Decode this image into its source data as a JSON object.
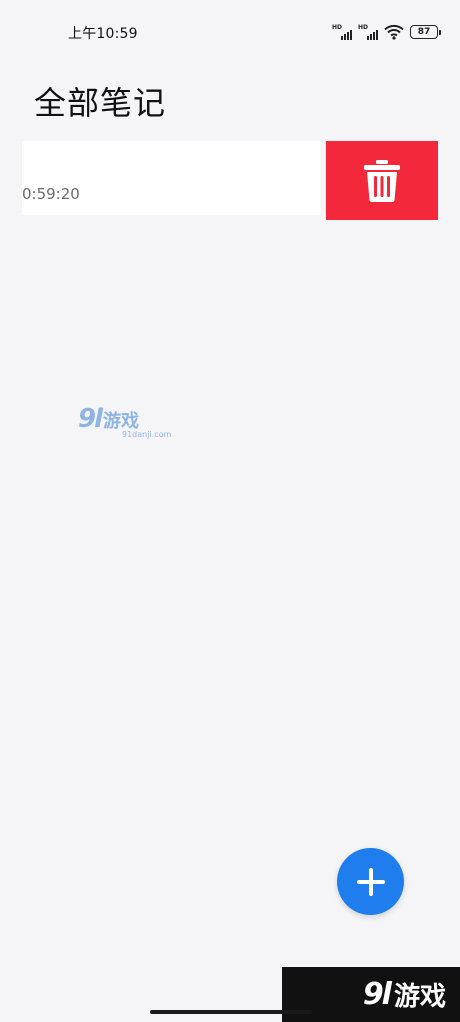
{
  "status_bar": {
    "time": "上午10:59",
    "signal_1_label": "HD",
    "signal_2_label": "HD",
    "battery": "87"
  },
  "header": {
    "title": "全部笔记"
  },
  "notes": [
    {
      "time": "0:59:20",
      "delete_icon": "trash-icon"
    }
  ],
  "watermark": {
    "number": "9l",
    "name": "游戏",
    "url": "91danji.com"
  },
  "fab": {
    "icon": "plus-icon"
  },
  "corner_banner": {
    "number": "9l",
    "name": "游戏"
  },
  "colors": {
    "background": "#f5f5f7",
    "delete": "#f4283b",
    "fab": "#1f7ded"
  }
}
